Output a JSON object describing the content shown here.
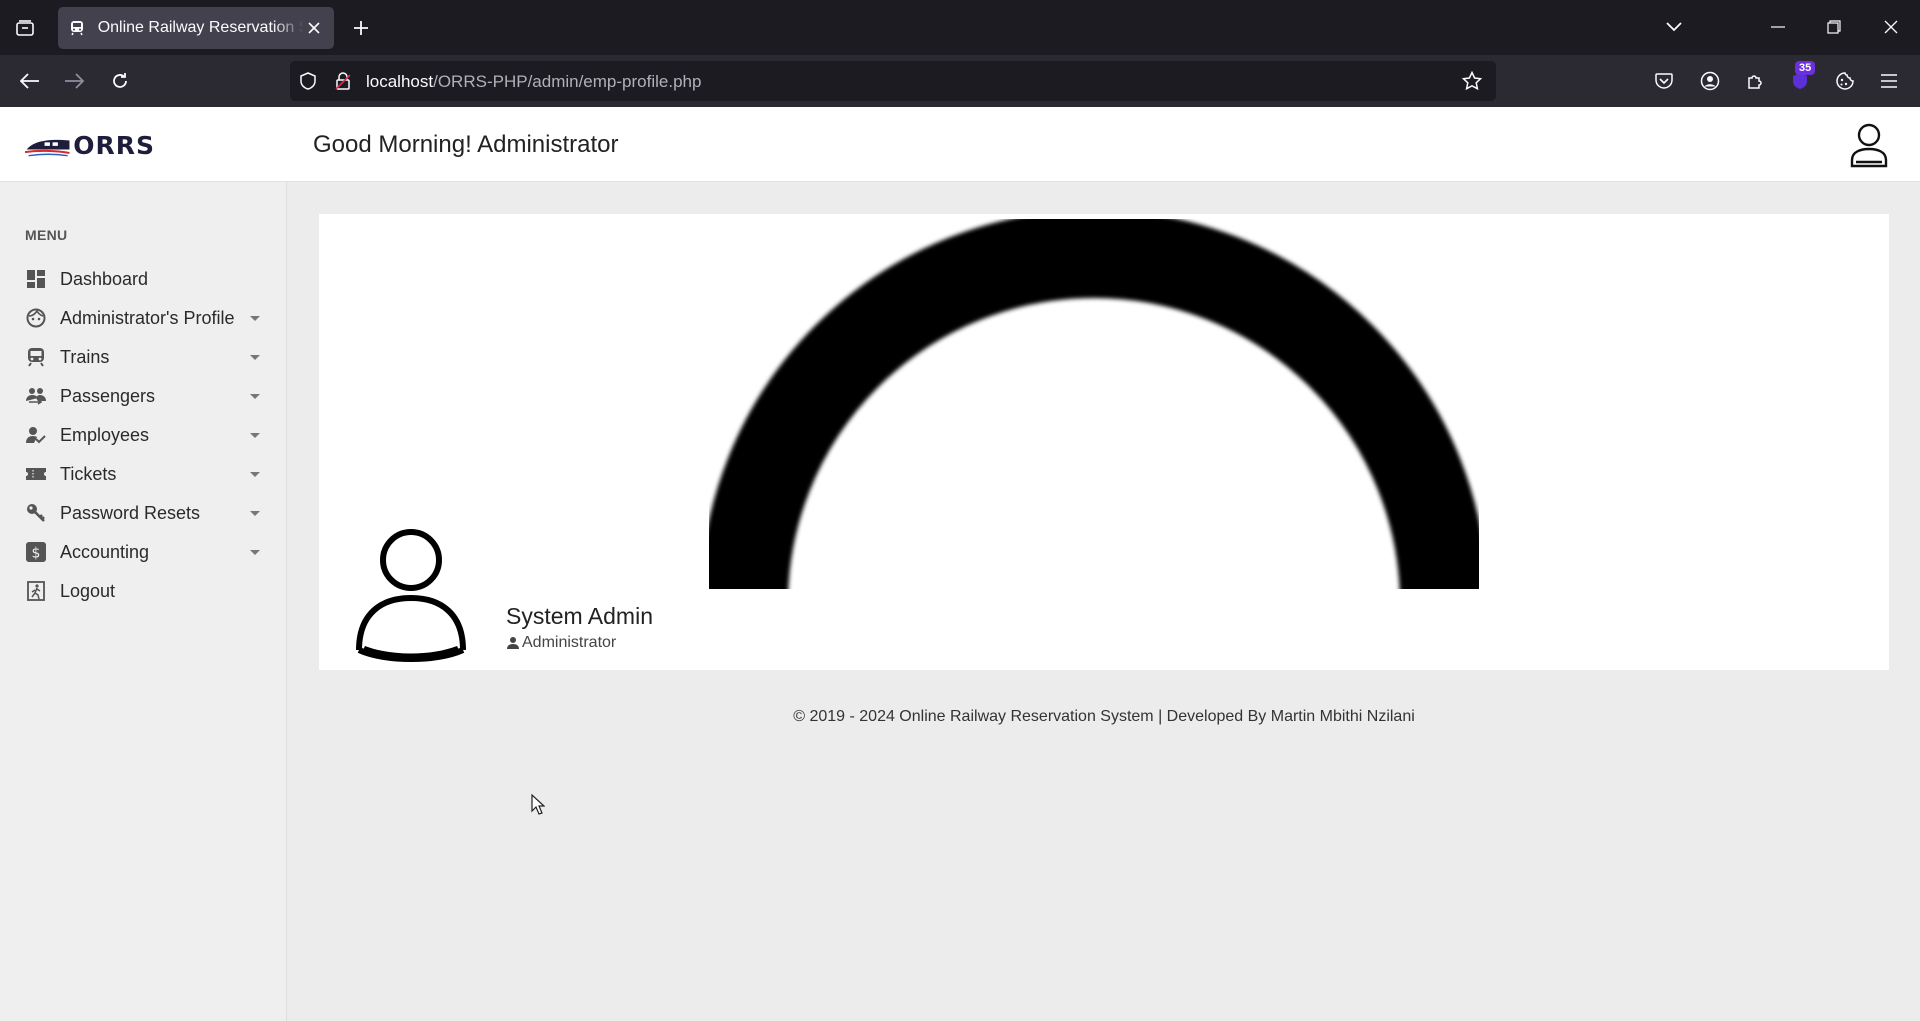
{
  "browser": {
    "tab_title": "Online Railway Reservation System",
    "url_host": "localhost",
    "url_path": "/ORRS-PHP/admin/emp-profile.php",
    "extension_badge": "35"
  },
  "header": {
    "logo_text": "ORRS",
    "greeting": "Good Morning! Administrator"
  },
  "sidebar": {
    "menu_label": "MENU",
    "items": [
      {
        "label": "Dashboard",
        "icon": "dashboard-icon",
        "has_caret": false
      },
      {
        "label": "Administrator's Profile",
        "icon": "face-icon",
        "has_caret": true
      },
      {
        "label": "Trains",
        "icon": "train-icon",
        "has_caret": true
      },
      {
        "label": "Passengers",
        "icon": "people-icon",
        "has_caret": true
      },
      {
        "label": "Employees",
        "icon": "employee-check-icon",
        "has_caret": true
      },
      {
        "label": "Tickets",
        "icon": "ticket-icon",
        "has_caret": true
      },
      {
        "label": "Password Resets",
        "icon": "key-icon",
        "has_caret": true
      },
      {
        "label": "Accounting",
        "icon": "dollar-icon",
        "has_caret": true
      },
      {
        "label": "Logout",
        "icon": "logout-icon",
        "has_caret": false
      }
    ]
  },
  "profile": {
    "name": "System Admin",
    "role": "Administrator"
  },
  "footer": {
    "text": "© 2019 - 2024 Online Railway Reservation System | Developed By Martin Mbithi Nzilani"
  },
  "colors": {
    "browser_tabbar": "#1c1b22",
    "browser_navbar": "#2b2a33",
    "page_background": "#ececec",
    "sidebar_background": "#efefef",
    "card_background": "#ffffff",
    "logo_red": "#d62b2b",
    "logo_navy": "#1e1e3c"
  }
}
